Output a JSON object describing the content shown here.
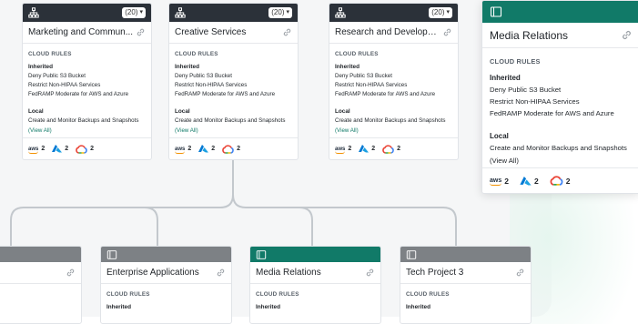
{
  "top_cards": [
    {
      "title": "Marketing and Commun...",
      "count": "(20)"
    },
    {
      "title": "Creative Services",
      "count": "(20)"
    },
    {
      "title": "Research and Developm...",
      "count": "(20)"
    }
  ],
  "rules": {
    "section": "CLOUD RULES",
    "inherited_label": "Inherited",
    "inherited": [
      "Deny Public S3 Bucket",
      "Restrict Non-HIPAA Services",
      "FedRAMP Moderate for AWS and Azure"
    ],
    "local_label": "Local",
    "local": [
      "Create and Monitor Backups and Snapshots"
    ],
    "view_all": "(View All)"
  },
  "clouds": [
    {
      "icon": "aws-icon",
      "label": "aws",
      "count": "2"
    },
    {
      "icon": "azure-icon",
      "count": "2"
    },
    {
      "icon": "gcp-icon",
      "count": "2"
    }
  ],
  "big_card": {
    "title": "Media Relations"
  },
  "bottom_cards": [
    {
      "title": "",
      "variant": "gray"
    },
    {
      "title": "Enterprise Applications",
      "variant": "gray"
    },
    {
      "title": "Media Relations",
      "variant": "teal"
    },
    {
      "title": "Tech Project 3",
      "variant": "gray"
    }
  ],
  "colors": {
    "accent": "#117a68",
    "header_dark": "#2b3139",
    "header_gray": "#7d8185",
    "connector": "#c3c8cd"
  }
}
